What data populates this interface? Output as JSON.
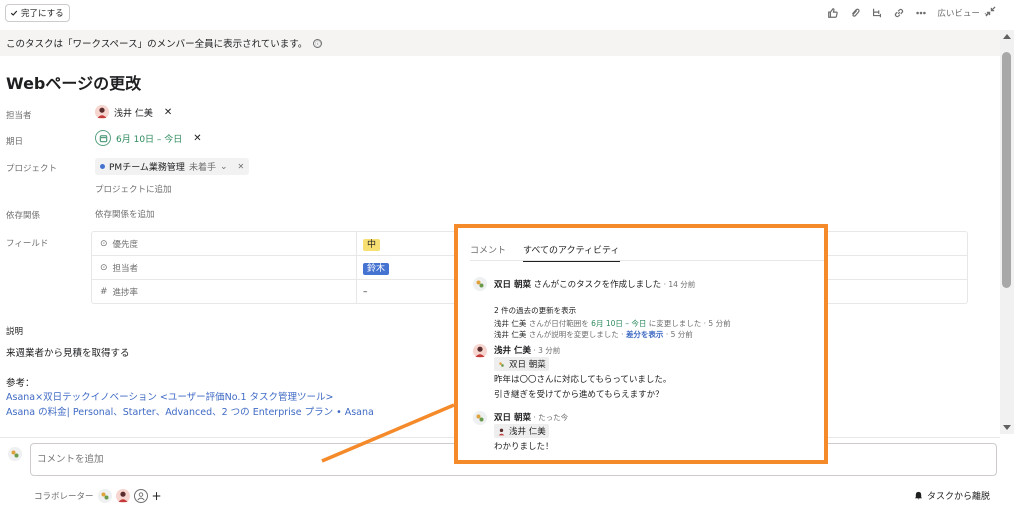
{
  "toolbar": {
    "complete_label": "完了にする",
    "wide_view_label": "広いビュー"
  },
  "banner": {
    "text": "このタスクは「ワークスペース」のメンバー全員に表示されています。",
    "info_glyph": "ⓘ"
  },
  "task": {
    "title": "Webページの更改",
    "assignee_label": "担当者",
    "assignee_name": "浅井 仁美",
    "due_label": "期日",
    "due_value": "6月 10日 – 今日",
    "project_label": "プロジェクト",
    "project_name": "PMチーム業務管理",
    "project_status": "未着手",
    "project_add": "プロジェクトに追加",
    "dependency_label": "依存関係",
    "dependency_add": "依存関係を追加",
    "fields_label": "フィールド",
    "fields": [
      {
        "name": "優先度",
        "value": "中"
      },
      {
        "name": "担当者",
        "value": "鈴木"
      },
      {
        "name": "進捗率",
        "value": "–"
      }
    ],
    "description_label": "説明",
    "description_text": "来週業者から見積を取得する",
    "reference_label": "参考：",
    "links": [
      "Asana×双日テックイノベーション <ユーザー評価No.1 タスク管理ツール>",
      "Asana の料金| Personal、Starter、Advanced、2 つの Enterprise プラン • Asana"
    ]
  },
  "comment_box": {
    "placeholder": "コメントを追加"
  },
  "footer": {
    "collaborators_label": "コラボレーター",
    "leave_label": "タスクから離脱"
  },
  "activity": {
    "tabs": [
      "コメント",
      "すべてのアクティビティ"
    ],
    "created_user": "双日 朝菜",
    "created_text": " さんがこのタスクを作成しました",
    "created_time": " · 14 分前",
    "past_updates_link": "2 件の過去の更新を表示",
    "update1_user": "浅井 仁美",
    "update1_text_a": " さんが日付範囲を ",
    "update1_date": "6月 10日 – 今日",
    "update1_text_b": " に変更しました",
    "update1_time": " · 5 分前",
    "update2_user": "浅井 仁美",
    "update2_text": " さんが説明を変更しました · ",
    "update2_link": "差分を表示",
    "update2_time": " · 5 分前",
    "comment1_user": "浅井 仁美",
    "comment1_time": " · 3 分前",
    "comment1_mention": "双日 朝菜",
    "comment1_line1": "昨年は〇〇さんに対応してもらっていました。",
    "comment1_line2": "引き継ぎを受けてから進めてもらえますか？",
    "comment2_user": "双日 朝菜",
    "comment2_time": " · たった今",
    "comment2_mention": "浅井 仁美",
    "comment2_line1": "わかりました！"
  },
  "colors": {
    "callout": "#f58a2a",
    "link": "#3f6ac4",
    "date_green": "#2a8a5c",
    "priority_yellow": "#f8df72",
    "assignee_blue": "#4573d2"
  }
}
